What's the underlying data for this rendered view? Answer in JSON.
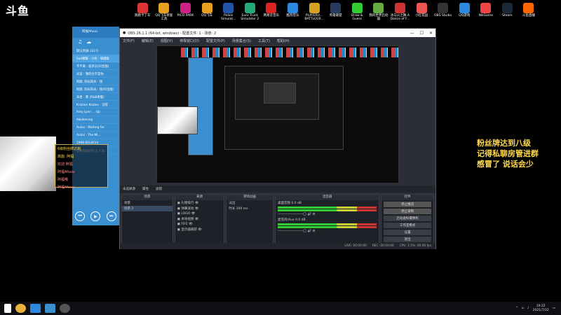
{
  "logo": "斗鱼",
  "desktop_icons": [
    {
      "label": "跑跑卡丁车",
      "color": "#d33"
    },
    {
      "label": "QQ飞车修复\n工具",
      "color": "#e8a020"
    },
    {
      "label": "PICO PARK",
      "color": "#c28"
    },
    {
      "label": "QQ飞车",
      "color": "#e8a020"
    },
    {
      "label": "Police\nSimulat...",
      "color": "#2255aa"
    },
    {
      "label": "Euro Truck\nSimulator 2",
      "color": "#2a7"
    },
    {
      "label": "网易云音乐",
      "color": "#d22"
    },
    {
      "label": "酷狗音乐",
      "color": "#2a8ae0"
    },
    {
      "label": "PLAYERU...\nBATTLEGR...",
      "color": "#d8a020"
    },
    {
      "label": "英雄联盟",
      "color": "#2a3a60"
    },
    {
      "label": "Draw &\nGuess",
      "color": "#3c3"
    },
    {
      "label": "我的世界启动\n器",
      "color": "#6a4"
    },
    {
      "label": "冰与火之舞 A\nDance of F...",
      "color": "#c33"
    },
    {
      "label": "小红花园",
      "color": "#e55"
    },
    {
      "label": "OBS Studio",
      "color": "#333"
    },
    {
      "label": "QQ游戏",
      "color": "#2a8ae0"
    },
    {
      "label": "WeGame",
      "color": "#e44"
    },
    {
      "label": "Steam",
      "color": "#1b2838"
    },
    {
      "label": "斗鱼直播",
      "color": "#f60"
    }
  ],
  "overlay_text": [
    "粉丝牌达到八级",
    "记得私聊房管进群",
    "感冒了  说话会少"
  ],
  "player": {
    "title": "阿福Afuuu",
    "list_title": "默认列表 (317)",
    "songs": [
      "Sad朝暖 - 小优 - 锋缀版",
      "不不离 - 程序员(抖音版)",
      "光良 - 我的名字是你",
      "阿朗, 阳光阳光 - 钱",
      "阿朗, 阳光阳光 - 钱(抖音版)",
      "朱星 - 我 (R&B男版)",
      "Kristian Kostov - 记得",
      "Amy Lynn ... Up",
      "Awakening",
      "Aukai - Waiting for",
      "Aukai - The Mi...",
      "1998 BEL0014"
    ],
    "footer": "温暖而美好的,让人放..."
  },
  "chat": [
    {
      "text": "6级粉丝牌达到",
      "red": false
    },
    {
      "text": "高能: 阿福",
      "red": false
    },
    {
      "text": "欢迎 阿福",
      "red": true
    },
    {
      "text": "阿福Afuuu",
      "red": true
    },
    {
      "text": "阿福哦",
      "red": true
    },
    {
      "text": "阿福Afuuu",
      "red": true
    }
  ],
  "obs": {
    "title": "OBS 26.1.1 (64-bit, windows) - 配置文件: 1 - 场景: 2",
    "menu": [
      "文件(F)",
      "编辑(E)",
      "视图(V)",
      "停靠窗口(D)",
      "配置文件(P)",
      "场景集合(S)",
      "工具(T)",
      "帮助(H)"
    ],
    "sources_bar": [
      "未选择源",
      "属性",
      "滤镜"
    ],
    "scenes_header": "场景",
    "scenes": [
      "场景",
      "场景 2"
    ],
    "sources_header": "来源",
    "sources": [
      "礼物排行",
      "弹幕滚动",
      "LOGO",
      "本地视频",
      "FIFE",
      "显示器捕获"
    ],
    "transitions_header": "转场动画",
    "transition_type": "淡出",
    "duration_label": "时长",
    "duration_value": "300 ms",
    "mixer_header": "混音器",
    "mixer": [
      {
        "name": "桌面音频",
        "db": "0.0 dB"
      },
      {
        "name": "麦克风/Aux",
        "db": "0.0 dB"
      }
    ],
    "controls_header": "控件",
    "controls": [
      "停止推流",
      "停止录制",
      "启动虚拟摄像机",
      "工作室模式",
      "设置",
      "退出"
    ],
    "status": [
      "LIVE: 00:00:00",
      "REC: 00:00:00",
      "CPU: 2.5%, 60.00 fps"
    ]
  },
  "tray": {
    "time": "19:22",
    "date": "2021/7/22"
  }
}
